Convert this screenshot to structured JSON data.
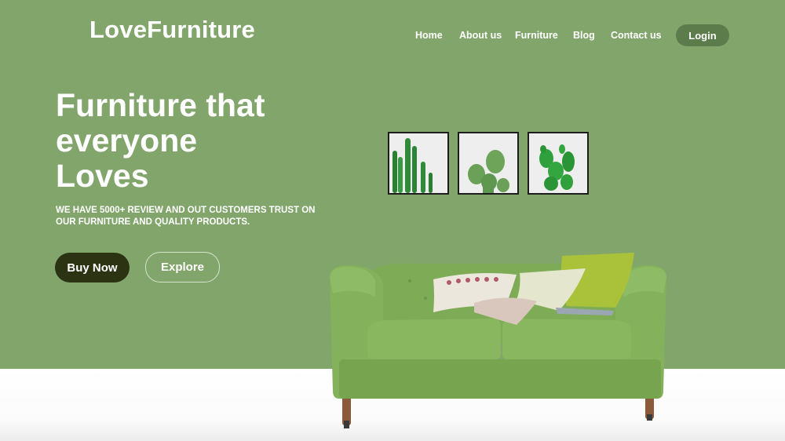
{
  "header": {
    "logo": "LoveFurniture",
    "nav": [
      {
        "label": "Home"
      },
      {
        "label": "About us"
      },
      {
        "label": "Furniture"
      },
      {
        "label": "Blog"
      },
      {
        "label": "Contact us"
      }
    ],
    "login_label": "Login"
  },
  "hero": {
    "headline_lines": [
      "Furniture that",
      "everyone",
      "Loves"
    ],
    "subtitle_lines": [
      "WE HAVE 5000+ REVIEW AND OUT CUSTOMERS TRUST ON",
      "OUR FURNITURE AND QUALITY PRODUCTS."
    ],
    "buy_label": "Buy Now",
    "explore_label": "Explore"
  },
  "colors": {
    "background": "#82a56c",
    "login_button": "#5c7d4b",
    "buy_button": "#2c3313",
    "sofa": "#7fa95a",
    "floor": "#ffffff"
  },
  "images": {
    "artwork": [
      "tall-cactus-print",
      "round-cactus-print",
      "prickly-pear-print"
    ],
    "product": "green-velvet-sofa"
  }
}
